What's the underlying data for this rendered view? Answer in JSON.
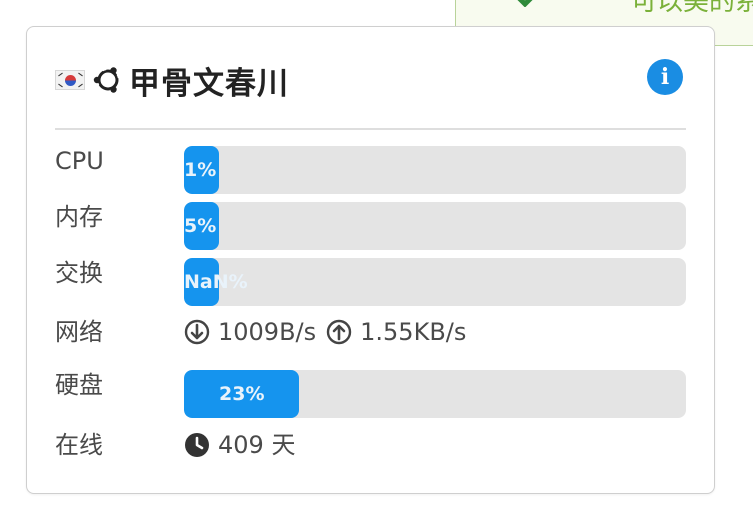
{
  "toast": {
    "text": "可以美的系",
    "icon": "chevron-down-icon"
  },
  "server": {
    "flag_icon": "south-korea-flag-icon",
    "os_icon": "ubuntu-icon",
    "name": "甲骨文春川",
    "info_icon": "info-icon"
  },
  "metrics": {
    "cpu": {
      "label": "CPU",
      "value": 1,
      "text": "1%"
    },
    "mem": {
      "label": "内存",
      "value": 5,
      "text": "5%"
    },
    "swap": {
      "label": "交换",
      "value": 0,
      "text": "NaN%"
    },
    "disk": {
      "label": "硬盘",
      "value": 23,
      "text": "23%"
    }
  },
  "network": {
    "label": "网络",
    "download": "1009B/s",
    "upload": "1.55KB/s"
  },
  "uptime": {
    "label": "在线",
    "value": "409 天"
  },
  "colors": {
    "accent": "#1594ee",
    "track": "#e4e4e4",
    "info": "#1a8de3"
  }
}
